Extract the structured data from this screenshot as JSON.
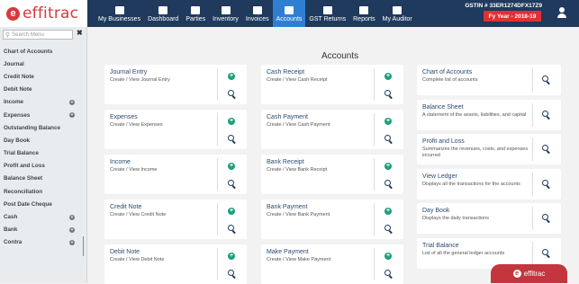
{
  "logo": {
    "letter": "e",
    "text": "effitrac"
  },
  "nav": [
    {
      "label": "My Businesses",
      "icon": "building-icon"
    },
    {
      "label": "Dashboard",
      "icon": "dashboard-icon"
    },
    {
      "label": "Parties",
      "icon": "parties-icon"
    },
    {
      "label": "Inventory",
      "icon": "inventory-icon"
    },
    {
      "label": "Invoices",
      "icon": "invoice-icon"
    },
    {
      "label": "Accounts",
      "icon": "accounts-icon",
      "active": true
    },
    {
      "label": "GST Returns",
      "icon": "gst-icon"
    },
    {
      "label": "Reports",
      "icon": "reports-icon"
    },
    {
      "label": "My Auditor",
      "icon": "auditor-icon"
    }
  ],
  "header": {
    "gstin": "GSTIN # 33ER1274DFX17Z9",
    "fy": "Fy Year - 2018-19"
  },
  "sidebar": {
    "search_placeholder": "Search Menu",
    "items": [
      {
        "label": "Chart of Accounts",
        "expandable": false
      },
      {
        "label": "Journal",
        "expandable": false
      },
      {
        "label": "Credit Note",
        "expandable": false
      },
      {
        "label": "Debit Note",
        "expandable": false
      },
      {
        "label": "Income",
        "expandable": true
      },
      {
        "label": "Expenses",
        "expandable": true
      },
      {
        "label": "Outstanding Balance",
        "expandable": false
      },
      {
        "label": "Day Book",
        "expandable": false
      },
      {
        "label": "Trial Balance",
        "expandable": false
      },
      {
        "label": "Profit and Loss",
        "expandable": false
      },
      {
        "label": "Balance Sheet",
        "expandable": false
      },
      {
        "label": "Reconciliation",
        "expandable": false
      },
      {
        "label": "Post Date Cheque",
        "expandable": false
      },
      {
        "label": "Cash",
        "expandable": true
      },
      {
        "label": "Bank",
        "expandable": true
      },
      {
        "label": "Contra",
        "expandable": true
      }
    ]
  },
  "main": {
    "title": "Accounts",
    "col1": [
      {
        "title": "Journal Entry",
        "sub": "Create / View Journal Entry"
      },
      {
        "title": "Expenses",
        "sub": "Create / View Expenses"
      },
      {
        "title": "Income",
        "sub": "Create / View Income"
      },
      {
        "title": "Credit Note",
        "sub": "Create / View Credit Note"
      },
      {
        "title": "Debit Note",
        "sub": "Create / View Debit Note"
      }
    ],
    "col2": [
      {
        "title": "Cash Receipt",
        "sub": "Create / View Cash Receipt"
      },
      {
        "title": "Cash Payment",
        "sub": "Create / View Cash Payment"
      },
      {
        "title": "Bank Receipt",
        "sub": "Create / View Bank Receipt"
      },
      {
        "title": "Bank Payment",
        "sub": "Create / View Bank Payment"
      },
      {
        "title": "Make Payment",
        "sub": "Create / View Make Payment"
      }
    ],
    "col3": [
      {
        "title": "Chart of Accounts",
        "sub": "Complete list of accounts"
      },
      {
        "title": "Balance Sheet",
        "sub": "A statement of the assets, liabilities, and capital"
      },
      {
        "title": "Profit and Loss",
        "sub": "Summarizes the revenues, costs, and expenses incurred"
      },
      {
        "title": "View Ledger",
        "sub": "Displays all the transactions for the accounts"
      },
      {
        "title": "Day Book",
        "sub": "Displays the daily transactions"
      },
      {
        "title": "Trial Balance",
        "sub": "List of all the general ledger accounts"
      }
    ]
  },
  "footer_badge": {
    "letter": "e",
    "text": "effitrac"
  },
  "colors": {
    "topbar": "#1f3a5c",
    "active_nav": "#2e7fd1",
    "brand": "#d9383f",
    "add": "#1aa07a",
    "fy_badge": "#e03131"
  }
}
